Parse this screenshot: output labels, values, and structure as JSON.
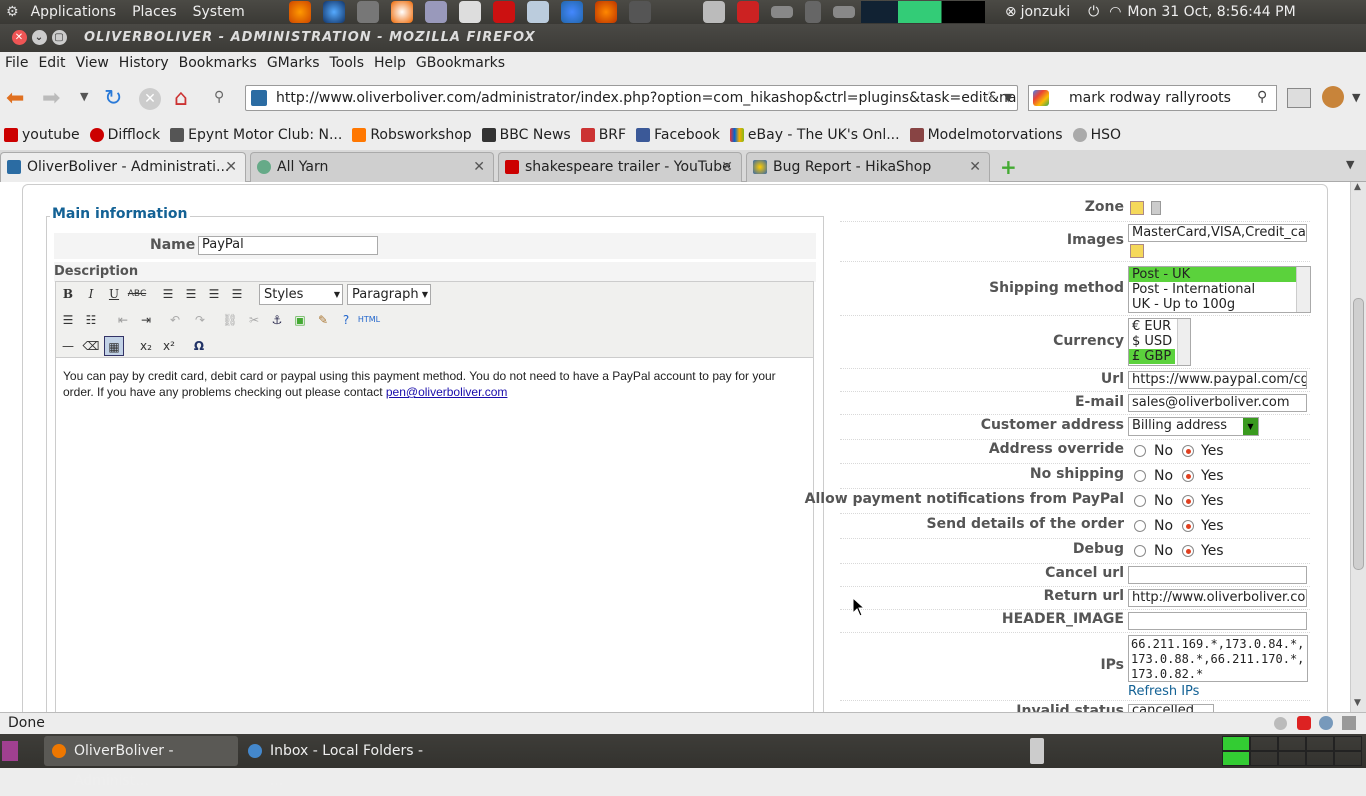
{
  "top_panel": {
    "menus": [
      "Applications",
      "Places",
      "System"
    ],
    "user": "jonzuki",
    "clock": "Mon 31 Oct,  8:56:44 PM"
  },
  "window": {
    "title": "OliverBoliver - Administration - Mozilla Firefox"
  },
  "menubar": [
    "File",
    "Edit",
    "View",
    "History",
    "Bookmarks",
    "GMarks",
    "Tools",
    "Help",
    "GBookmarks"
  ],
  "nav": {
    "url": "http://www.oliverboliver.com/administrator/index.php?option=com_hikashop&ctrl=plugins&task=edit&nam",
    "search": "mark rodway rallyroots"
  },
  "bookmarks": [
    "youtube",
    "Difflock",
    "Epynt Motor Club: N...",
    "Robsworkshop",
    "BBC News",
    "BRF",
    "Facebook",
    "eBay - The UK's Onl...",
    "Modelmotorvations",
    "HSO"
  ],
  "tabs": [
    "OliverBoliver - Administrati...",
    "All Yarn",
    "shakespeare trailer - YouTube",
    "Bug Report - HikaShop"
  ],
  "main": {
    "legend": "Main information",
    "name_label": "Name",
    "name_value": "PayPal",
    "description_label": "Description",
    "styles_select": "Styles",
    "format_select": "Paragraph",
    "html_btn": "HTML",
    "editor_text": "You can pay by credit card, debit card or paypal using this payment method. You do not need to have a PayPal account to pay for your order. If you have any problems checking out please contact ",
    "editor_link": "pen@oliverboliver.com"
  },
  "side": {
    "zone_label": "Zone",
    "images_label": "Images",
    "images_value": "MasterCard,VISA,Credit_card,",
    "shipping_label": "Shipping method",
    "shipping_options": [
      "Post - UK",
      "Post - International",
      "UK - Up to 100g"
    ],
    "currency_label": "Currency",
    "currency_options": [
      "€ EUR",
      "$ USD",
      "£ GBP"
    ],
    "url_label": "Url",
    "url_value": "https://www.paypal.com/cgi-b",
    "email_label": "E-mail",
    "email_value": "sales@oliverboliver.com",
    "customer_address_label": "Customer address",
    "customer_address_value": "Billing address",
    "address_override_label": "Address override",
    "no_shipping_label": "No shipping",
    "notifications_label": "Allow payment notifications from PayPal",
    "send_details_label": "Send details of the order",
    "debug_label": "Debug",
    "no": "No",
    "yes": "Yes",
    "cancel_url_label": "Cancel url",
    "return_url_label": "Return url",
    "return_url_value": "http://www.oliverboliver.com/",
    "header_image_label": "HEADER_IMAGE",
    "ips_label": "IPs",
    "ips_value": "66.211.169.*,173.0.84.*,173.0.88.*,66.211.170.*,173.0.82.*",
    "refresh_ips": "Refresh IPs",
    "invalid_status_label": "Invalid status",
    "invalid_status_value": "cancelled"
  },
  "status": "Done",
  "taskbar": [
    "OliverBoliver - Administ...",
    "Inbox - Local Folders - ..."
  ],
  "colors": {
    "selected_option": "#5bd23c",
    "link": "#1a0dab",
    "legend": "#146295"
  }
}
